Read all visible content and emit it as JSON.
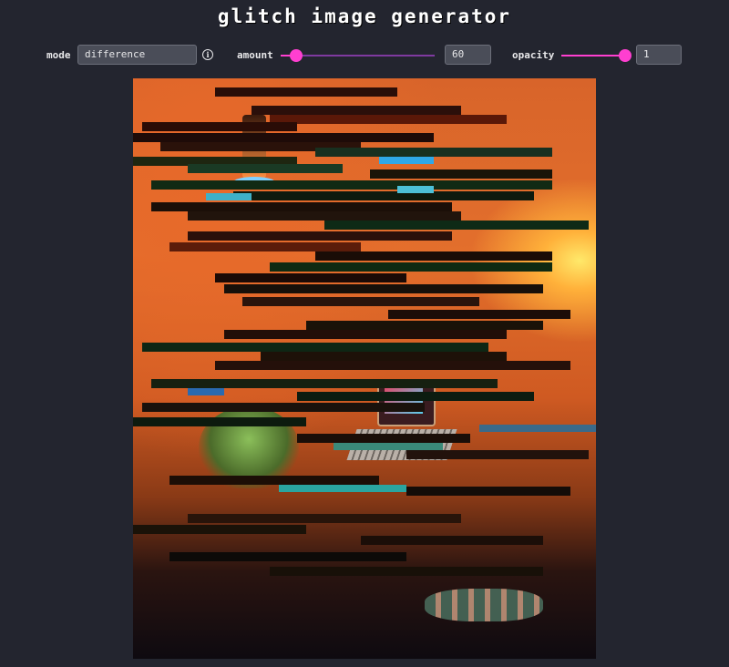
{
  "app": {
    "title": "glitch image generator"
  },
  "controls": {
    "mode": {
      "label": "mode",
      "value": "difference"
    },
    "amount": {
      "label": "amount",
      "value": "60",
      "level": 0.1
    },
    "opacity": {
      "label": "opacity",
      "value": "1",
      "level": 1.0
    }
  },
  "colors": {
    "background": "#23252f",
    "accent": "#ff3fd0",
    "field": "#4a4d58"
  },
  "icons": {
    "mode_info": "info-icon"
  },
  "canvas": {
    "content": "glitched photograph"
  }
}
